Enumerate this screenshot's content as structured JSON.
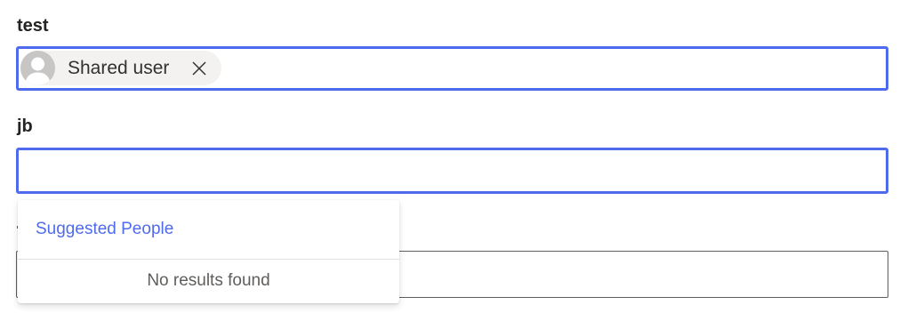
{
  "fields": {
    "test": {
      "label": "test",
      "selected_persona": {
        "name": "Shared user",
        "avatar_icon": "default-user-icon",
        "remove_icon": "close-icon"
      }
    },
    "jb": {
      "label": "jb",
      "input_value": ""
    }
  },
  "suggestions": {
    "header": "Suggested People",
    "empty_message": "No results found"
  },
  "colors": {
    "accent": "#4f6bed",
    "persona_bg": "#f3f2f1",
    "avatar_bg": "#c8c6c4"
  }
}
